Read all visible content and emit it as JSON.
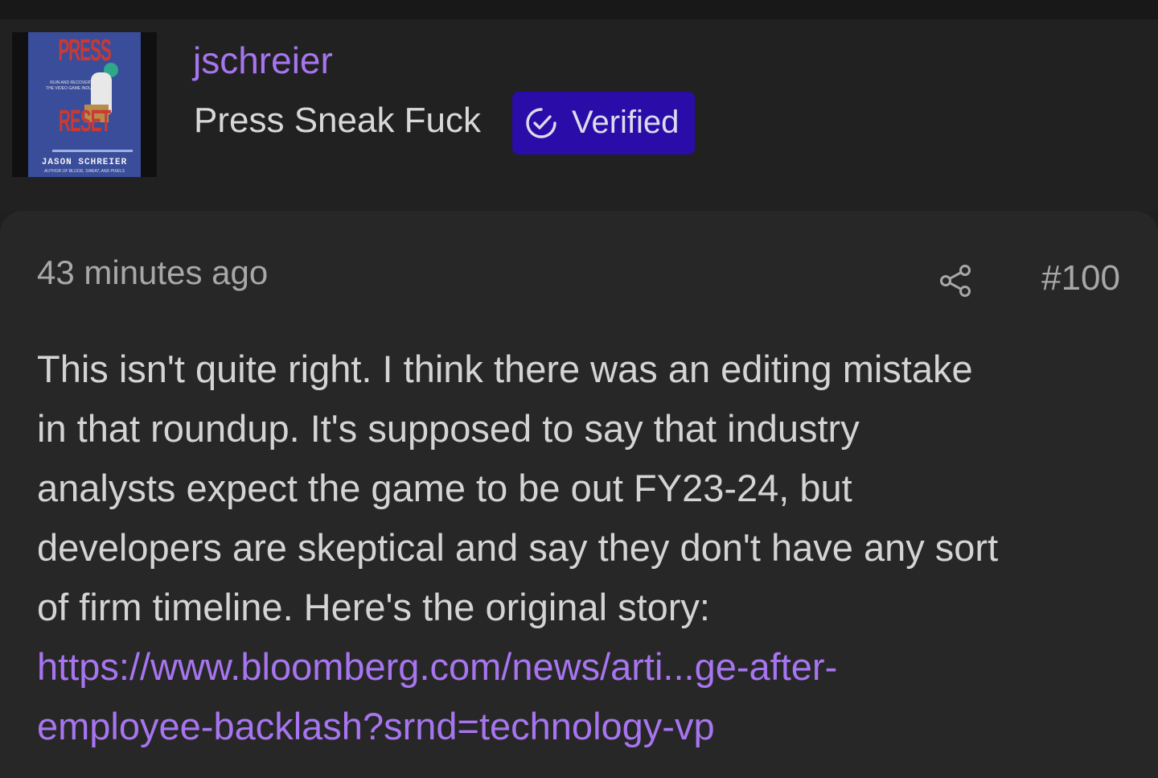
{
  "avatar": {
    "book_title_top": "PRESS",
    "book_title_bottom": "RESET",
    "book_subtitle": "RUIN AND RECOVERY IN THE VIDEO GAME INDUSTRY",
    "book_author": "JASON SCHREIER",
    "book_tagline": "AUTHOR OF BLOOD, SWEAT, AND PIXELS"
  },
  "user": {
    "username": "jschreier",
    "tagline": "Press Sneak Fuck",
    "badge_label": "Verified"
  },
  "post": {
    "timestamp": "43 minutes ago",
    "post_number": "#100",
    "body_lines": [
      "This isn't quite right. I think there was an editing mistake",
      "in that roundup. It's supposed to say that industry",
      "analysts expect the game to be out FY23-24, but",
      "developers are skeptical and say they don't have any sort",
      "of firm timeline. Here's the original story:"
    ],
    "link_lines": [
      "https://www.bloomberg.com/news/arti...ge-after-",
      "employee-backlash?srnd=technology-vp"
    ]
  },
  "icons": {
    "badge_icon": "check-circle-icon",
    "share_icon": "share-icon"
  },
  "colors": {
    "accent": "#a775f0",
    "badge_bg": "#2a0ca8",
    "page_bg": "#1f1f1f",
    "post_bg": "#272727"
  }
}
